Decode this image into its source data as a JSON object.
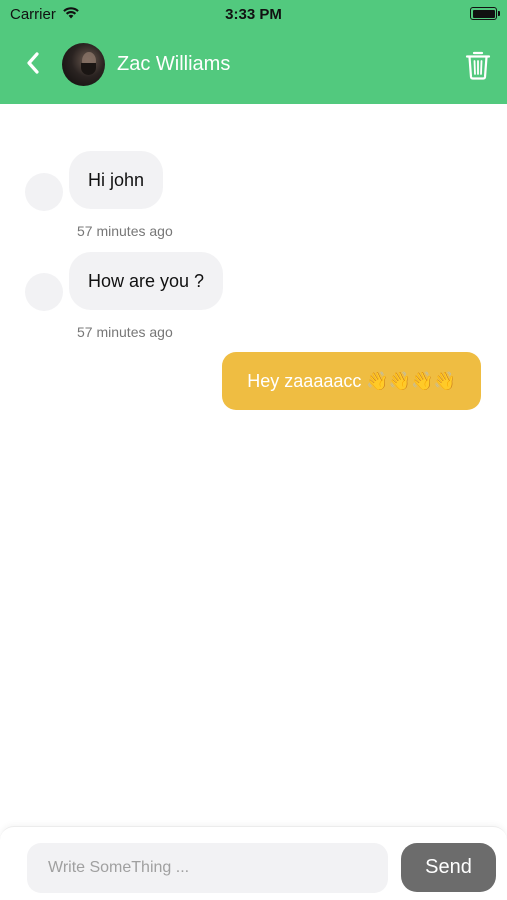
{
  "status_bar": {
    "carrier": "Carrier",
    "time": "3:33 PM",
    "icons": [
      "wifi-icon",
      "battery-icon"
    ]
  },
  "header": {
    "contact_name": "Zac Williams",
    "back_icon": "chevron-left-icon",
    "delete_icon": "trash-icon",
    "background_color": "#52c97e"
  },
  "messages": [
    {
      "direction": "incoming",
      "text": "Hi john",
      "time": "57 minutes ago"
    },
    {
      "direction": "incoming",
      "text": "How are you ?",
      "time": "57 minutes ago"
    },
    {
      "direction": "outgoing",
      "text": "Hey zaaaaacc 👋👋👋👋",
      "time": ""
    }
  ],
  "composer": {
    "placeholder": "Write SomeThing ...",
    "value": "",
    "send_label": "Send"
  },
  "colors": {
    "accent_green": "#52c97e",
    "outgoing_bubble": "#efbd42",
    "incoming_bubble": "#f2f2f4",
    "send_button": "#6c6c6c"
  }
}
